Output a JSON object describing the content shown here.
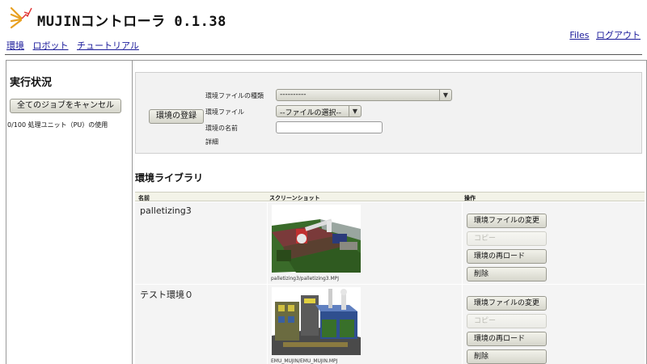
{
  "app": {
    "title": "MUJINコントローラ 0.1.38"
  },
  "nav": {
    "left": [
      {
        "label": "環境"
      },
      {
        "label": "ロボット"
      },
      {
        "label": "チュートリアル"
      }
    ],
    "right": [
      {
        "label": "Files"
      },
      {
        "label": "ログアウト"
      }
    ]
  },
  "sidebar": {
    "title": "実行状況",
    "cancel_all_label": "全てのジョブをキャンセル",
    "pu_usage": "0/100 処理ユニット（PU）の使用"
  },
  "register_panel": {
    "register_button": "環境の登録",
    "file_type_label": "環境ファイルの種類",
    "file_type_value": "----------",
    "file_label": "環境ファイル",
    "file_select_value": "--ファイルの選択--",
    "name_label": "環境の名前",
    "name_value": "",
    "details_label": "詳細"
  },
  "library": {
    "title": "環境ライブラリ",
    "columns": {
      "name": "名前",
      "screenshot": "スクリーンショット",
      "actions": "操作"
    },
    "rows": [
      {
        "name": "palletizing3",
        "caption": "palletizing3/palletizing3.MPJ",
        "actions": [
          "環境ファイルの変更",
          "コピー",
          "環境の再ロード",
          "削除"
        ]
      },
      {
        "name": "テスト環境０",
        "caption": "EMU_MUJIN/EMU_MUJIN.MPJ",
        "actions": [
          "環境ファイルの変更",
          "コピー",
          "環境の再ロード",
          "削除"
        ]
      }
    ]
  },
  "colors": {
    "link": "#1a1a9a",
    "panel_bg": "#f2f2f2",
    "header_bg": "#f3f3e8"
  }
}
